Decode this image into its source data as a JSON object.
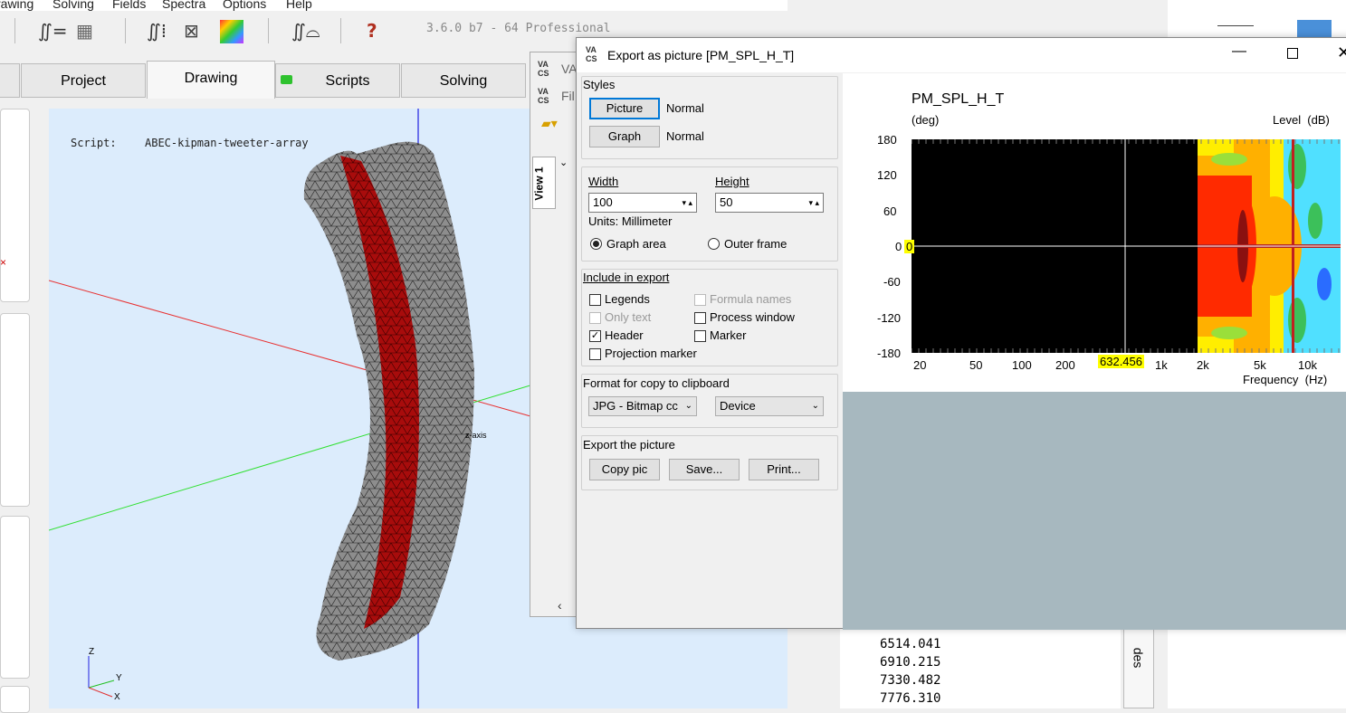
{
  "menu": [
    "rawing",
    "Solving",
    "Fields",
    "Spectra",
    "Options",
    "Help"
  ],
  "toolbar": {
    "version": "3.6.0 b7 - 64 Professional"
  },
  "tabs": [
    "Project",
    "Drawing",
    "Scripts",
    "Solving"
  ],
  "viewport": {
    "script_label": "Script:",
    "script_name": "ABEC-kipman-tweeter-array",
    "axis_z": "Z",
    "axis_y": "Y",
    "axis_x": "X",
    "axis_tag": "z-axis"
  },
  "vawindow": {
    "title1": "VA",
    "title2": "Fil",
    "tab": "View 1"
  },
  "numbers": [
    "6514.041",
    "6910.215",
    "7330.482",
    "7776.310"
  ],
  "side_tab": "des",
  "dialog": {
    "title": "Export as picture [PM_SPL_H_T]",
    "styles_label": "Styles",
    "picture_btn": "Picture",
    "picture_style": "Normal",
    "graph_btn": "Graph",
    "graph_style": "Normal",
    "width_label": "Width",
    "height_label": "Height",
    "width_value": "100",
    "height_value": "50",
    "units": "Units: Millimeter",
    "radio_graph": "Graph area",
    "radio_outer": "Outer frame",
    "include_label": "Include in export",
    "legends": "Legends",
    "formula_names": "Formula names",
    "only_text": "Only text",
    "process_window": "Process window",
    "header": "Header",
    "marker": "Marker",
    "projection_marker": "Projection marker",
    "format_label": "Format for copy to clipboard",
    "format_value": "JPG - Bitmap cc",
    "device_value": "Device",
    "export_label": "Export the picture",
    "copy_btn": "Copy pic",
    "save_btn": "Save...",
    "print_btn": "Print..."
  },
  "chart": {
    "title": "PM_SPL_H_T",
    "ylabel": "(deg)",
    "level_label": "Level  (dB)",
    "xlabel": "Frequency  (Hz)",
    "yticks": [
      "180",
      "120",
      "60",
      "0",
      "-60",
      "-120",
      "-180"
    ],
    "xticks": [
      "20",
      "50",
      "100",
      "200",
      "1k",
      "2k",
      "5k",
      "10k"
    ],
    "cursor_x": "632.456",
    "cursor_y": "0"
  },
  "chart_data": {
    "type": "heatmap",
    "title": "PM_SPL_H_T",
    "ylabel": "(deg)",
    "xlabel": "Frequency  (Hz)",
    "colorbar_label": "Level  (dB)",
    "x_scale": "log",
    "ylim": [
      -180,
      180
    ],
    "yticks": [
      180,
      120,
      60,
      0,
      -60,
      -120,
      -180
    ],
    "xticks": [
      "20",
      "50",
      "100",
      "200",
      "1k",
      "2k",
      "5k",
      "10k"
    ],
    "cursor": {
      "x": 632.456,
      "y": 0
    },
    "colors": {
      "background": "#000000",
      "high": "#ff2a00",
      "mid": "#ffb000",
      "low": "#ffee00",
      "lower": "#50e0ff"
    }
  }
}
